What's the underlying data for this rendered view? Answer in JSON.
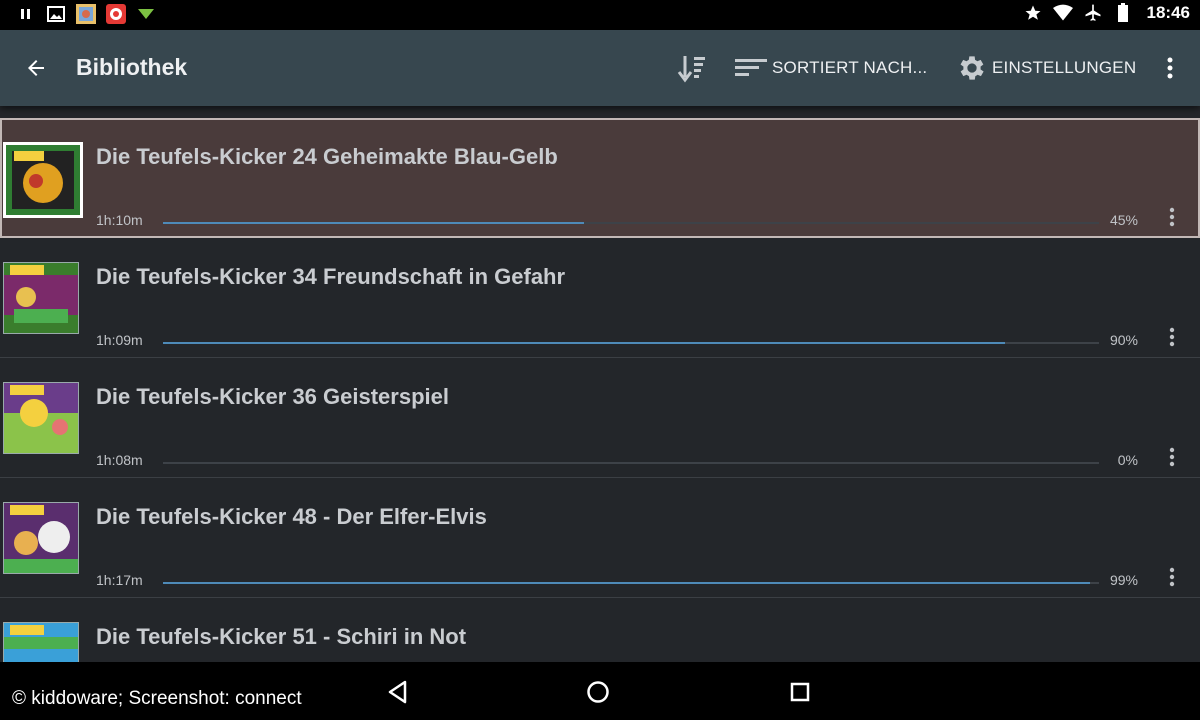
{
  "status_bar": {
    "time": "18:46",
    "left_icons": [
      "pause-icon",
      "image-icon",
      "app-thumbnail-icon",
      "target-app-icon",
      "download-arrow-icon"
    ],
    "right_icons": [
      "star-icon",
      "wifi-icon",
      "airplane-icon",
      "battery-icon"
    ]
  },
  "toolbar": {
    "title": "Bibliothek",
    "sort_label": "SORTIERT NACH...",
    "settings_label": "EINSTELLUNGEN"
  },
  "items": [
    {
      "title": "Die Teufels-Kicker 24 Geheimakte Blau-Gelb",
      "duration": "1h:10m",
      "percent_label": "45%",
      "progress": 0.45,
      "selected": true
    },
    {
      "title": "Die Teufels-Kicker 34 Freundschaft in Gefahr",
      "duration": "1h:09m",
      "percent_label": "90%",
      "progress": 0.9,
      "selected": false
    },
    {
      "title": "Die Teufels-Kicker 36 Geisterspiel",
      "duration": "1h:08m",
      "percent_label": "0%",
      "progress": 0.0,
      "selected": false
    },
    {
      "title": "Die Teufels-Kicker 48 - Der Elfer-Elvis",
      "duration": "1h:17m",
      "percent_label": "99%",
      "progress": 0.99,
      "selected": false
    },
    {
      "title": "Die Teufels-Kicker 51 - Schiri in Not",
      "duration": "",
      "percent_label": "",
      "progress": null,
      "selected": false
    }
  ],
  "credit": "© kiddoware; Screenshot: connect",
  "colors": {
    "toolbar": "#37474f",
    "background": "#23262a",
    "selected_row": "#4a3b3b",
    "progress": "#4e8ab8"
  }
}
